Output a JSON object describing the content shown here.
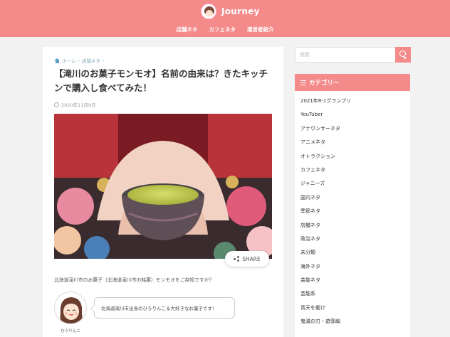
{
  "brand": {
    "name": "Journey"
  },
  "nav": [
    "店舗ネタ",
    "カフェネタ",
    "運営者紹介"
  ],
  "article": {
    "breadcrumb": [
      "ホーム",
      "店舗ネタ"
    ],
    "title": "【滝川のお菓子モンモオ】名前の由来は？きたキッチンで購入し食べてみた！",
    "date": "2020年11月9日",
    "share_label": "SHARE",
    "lead": "北海道滝川市のお菓子（北海道滝川市の銘菓）モンモオをご存知ですか？",
    "author_name": "ひろりんこ",
    "speech": "北海道滝川市出身のひろりんこ＆大好きなお菓子です！"
  },
  "search": {
    "placeholder": "検索"
  },
  "categories": {
    "heading": "カテゴリー",
    "items": [
      "2021年R-1グランプリ",
      "YouTuber",
      "アナウンサーネタ",
      "アニメネタ",
      "オトラクション",
      "カフェネタ",
      "ジャニーズ",
      "国内ネタ",
      "季節ネタ",
      "店舗ネタ",
      "政治ネタ",
      "未分類",
      "海外ネタ",
      "芸能ネタ",
      "芸能系",
      "青天を衝け",
      "鬼滅の刃・遊郭編"
    ]
  },
  "colors": {
    "accent": "#f48a8a",
    "link": "#5aa0c8"
  }
}
